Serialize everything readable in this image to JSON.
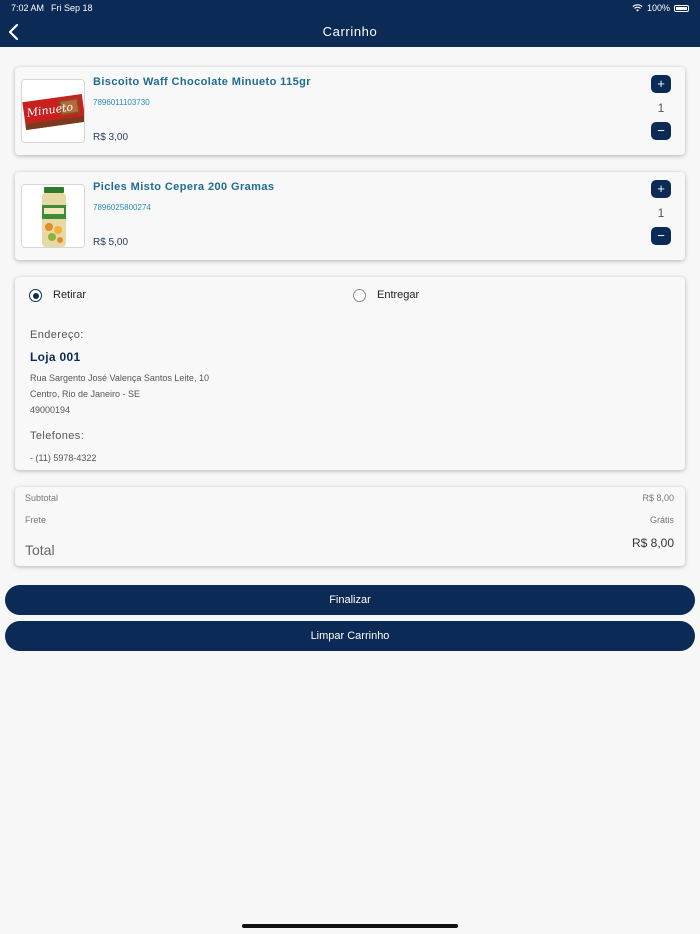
{
  "status": {
    "time": "7:02 AM",
    "date": "Fri Sep 18",
    "battery": "100%"
  },
  "nav": {
    "title": "Carrinho"
  },
  "products": [
    {
      "name": "Biscoito Waff Chocolate Minueto 115gr",
      "code": "7896011103730",
      "price": "R$ 3,00",
      "qty": "1",
      "package_text": "Minueto"
    },
    {
      "name": "Picles Misto Cepera 200 Gramas",
      "code": "7896025800274",
      "price": "R$ 5,00",
      "qty": "1"
    }
  ],
  "qty_controls": {
    "plus": "+",
    "minus": "−"
  },
  "delivery": {
    "option_pickup": "Retirar",
    "option_delivery": "Entregar",
    "selected": "Retirar",
    "address_label": "Endereço:",
    "store_name": "Loja 001",
    "address_lines": [
      "Rua Sargento José Valença Santos Leite, 10",
      "Centro, Rio de Janeiro - SE",
      "49000194"
    ],
    "phones_label": "Telefones:",
    "phone": "- (11) 5978-4322"
  },
  "totals": {
    "subtotal_label": "Subtotal",
    "subtotal": "R$ 8,00",
    "shipping_label": "Frete",
    "shipping": "Grátis",
    "total_label": "Total",
    "total": "R$ 8,00"
  },
  "buttons": {
    "finalize": "Finalizar",
    "clear": "Limpar Carrinho"
  },
  "colors": {
    "primary": "#0b2a55",
    "product_name": "#1e6c93",
    "background": "#f7f7f7"
  }
}
